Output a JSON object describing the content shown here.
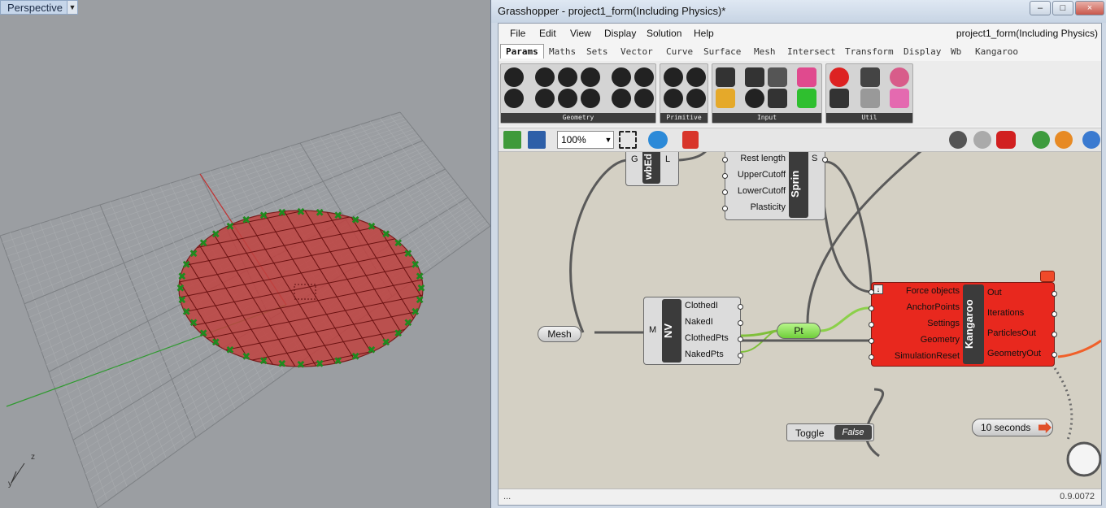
{
  "viewport": {
    "label": "Perspective",
    "axis_z": "z",
    "axis_y": "y"
  },
  "gh": {
    "title": "Grasshopper - project1_form(Including Physics)*",
    "doc_name": "project1_form(Including Physics)",
    "window_buttons": {
      "minimize": "–",
      "maximize": "□",
      "close": "×"
    },
    "menu": [
      "File",
      "Edit",
      "View",
      "Display",
      "Solution",
      "Help"
    ],
    "tabs": [
      "Params",
      "Maths",
      "Sets",
      "Vector",
      "Curve",
      "Surface",
      "Mesh",
      "Intersect",
      "Transform",
      "Display",
      "Wb",
      "Kangaroo"
    ],
    "active_tab": "Params",
    "panels": [
      "Geometry",
      "Primitive",
      "Input",
      "Util"
    ],
    "zoom": "100%",
    "status_left": "...",
    "version": "0.9.0072"
  },
  "canvas": {
    "wbedge": {
      "in": "G",
      "out": "L",
      "name": "wbEd"
    },
    "spring": {
      "inputs": [
        "Rest length",
        "UpperCutoff",
        "LowerCutoff",
        "Plasticity"
      ],
      "out": "S",
      "name": "Sprin"
    },
    "mesh_param": "Mesh",
    "nv": {
      "in": "M",
      "name": "NV",
      "outputs": [
        "ClothedI",
        "NakedI",
        "ClothedPts",
        "NakedPts"
      ]
    },
    "pt_param": "Pt",
    "kangaroo": {
      "name": "Kangaroo",
      "inputs": [
        "Force objects",
        "AnchorPoints",
        "Settings",
        "Geometry",
        "SimulationReset"
      ],
      "outputs": [
        "Out",
        "Iterations",
        "ParticlesOut",
        "GeometryOut"
      ]
    },
    "toggle": {
      "label": "Toggle",
      "value": "False"
    },
    "timer": "10 seconds"
  },
  "colors": {
    "kangaroo_red": "#e8281e",
    "mesh_fill": "#c0423f",
    "anchor_green": "#1f8a1f",
    "pt_green": "#8de05a",
    "canvas_bg": "#d4d0c4"
  }
}
